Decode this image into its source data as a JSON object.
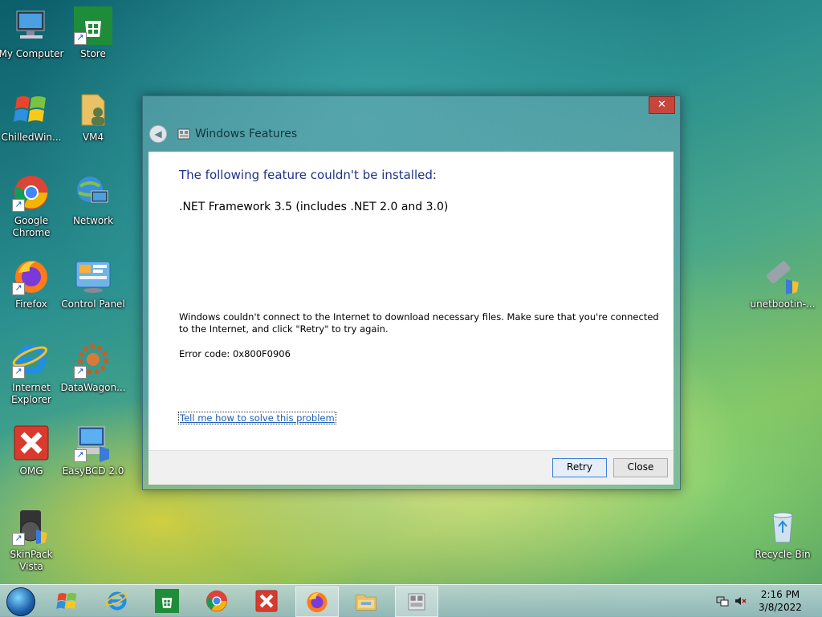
{
  "desktop": {
    "icons_left": [
      {
        "label": "My Computer",
        "icon": "computer-icon"
      },
      {
        "label": "Store",
        "icon": "store-icon"
      },
      {
        "label": "ChilledWin...",
        "icon": "windows-flag-icon"
      },
      {
        "label": "VM4",
        "icon": "folder-user-icon"
      },
      {
        "label": "Google Chrome",
        "icon": "chrome-icon"
      },
      {
        "label": "Network",
        "icon": "network-icon"
      },
      {
        "label": "Firefox",
        "icon": "firefox-icon"
      },
      {
        "label": "Control Panel",
        "icon": "control-panel-icon"
      },
      {
        "label": "Internet Explorer",
        "icon": "ie-icon"
      },
      {
        "label": "DataWagon...",
        "icon": "gear-icon"
      },
      {
        "label": "OMG",
        "icon": "red-x-icon"
      },
      {
        "label": "EasyBCD 2.0",
        "icon": "easybcd-icon"
      },
      {
        "label": "SkinPack Vista",
        "icon": "skinpack-icon"
      }
    ],
    "icons_right": [
      {
        "label": "unetbootin-...",
        "icon": "usb-shield-icon"
      },
      {
        "label": "Recycle Bin",
        "icon": "recycle-bin-icon"
      }
    ]
  },
  "dialog": {
    "title": "Windows Features",
    "heading": "The following feature couldn't be installed:",
    "feature": ".NET Framework 3.5 (includes .NET 2.0 and 3.0)",
    "message": "Windows couldn't connect to the Internet to download necessary files. Make sure that you're connected to the Internet, and click \"Retry\" to try again.",
    "error_code": "Error code: 0x800F0906",
    "help_link": "Tell me how to solve this problem",
    "retry_label": "Retry",
    "close_label": "Close",
    "close_glyph": "✕"
  },
  "taskbar": {
    "items": [
      "start-orb",
      "windows-flag-icon",
      "ie-icon",
      "store-icon",
      "chrome-icon",
      "red-x-icon",
      "firefox-icon",
      "file-explorer-icon",
      "windows-features-icon"
    ],
    "time": "2:16 PM",
    "date": "3/8/2022"
  },
  "colors": {
    "heading": "#1e3287",
    "link": "#1a5fb4",
    "close_button": "#c7463c"
  }
}
